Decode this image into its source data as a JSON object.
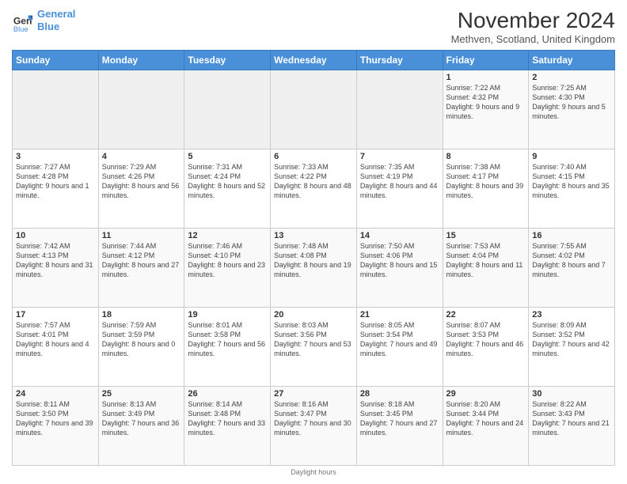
{
  "app": {
    "logo_line1": "General",
    "logo_line2": "Blue"
  },
  "title": "November 2024",
  "location": "Methven, Scotland, United Kingdom",
  "footer": "Daylight hours",
  "headers": [
    "Sunday",
    "Monday",
    "Tuesday",
    "Wednesday",
    "Thursday",
    "Friday",
    "Saturday"
  ],
  "weeks": [
    [
      {
        "day": "",
        "info": ""
      },
      {
        "day": "",
        "info": ""
      },
      {
        "day": "",
        "info": ""
      },
      {
        "day": "",
        "info": ""
      },
      {
        "day": "",
        "info": ""
      },
      {
        "day": "1",
        "info": "Sunrise: 7:22 AM\nSunset: 4:32 PM\nDaylight: 9 hours\nand 9 minutes."
      },
      {
        "day": "2",
        "info": "Sunrise: 7:25 AM\nSunset: 4:30 PM\nDaylight: 9 hours\nand 5 minutes."
      }
    ],
    [
      {
        "day": "3",
        "info": "Sunrise: 7:27 AM\nSunset: 4:28 PM\nDaylight: 9 hours\nand 1 minute."
      },
      {
        "day": "4",
        "info": "Sunrise: 7:29 AM\nSunset: 4:26 PM\nDaylight: 8 hours\nand 56 minutes."
      },
      {
        "day": "5",
        "info": "Sunrise: 7:31 AM\nSunset: 4:24 PM\nDaylight: 8 hours\nand 52 minutes."
      },
      {
        "day": "6",
        "info": "Sunrise: 7:33 AM\nSunset: 4:22 PM\nDaylight: 8 hours\nand 48 minutes."
      },
      {
        "day": "7",
        "info": "Sunrise: 7:35 AM\nSunset: 4:19 PM\nDaylight: 8 hours\nand 44 minutes."
      },
      {
        "day": "8",
        "info": "Sunrise: 7:38 AM\nSunset: 4:17 PM\nDaylight: 8 hours\nand 39 minutes."
      },
      {
        "day": "9",
        "info": "Sunrise: 7:40 AM\nSunset: 4:15 PM\nDaylight: 8 hours\nand 35 minutes."
      }
    ],
    [
      {
        "day": "10",
        "info": "Sunrise: 7:42 AM\nSunset: 4:13 PM\nDaylight: 8 hours\nand 31 minutes."
      },
      {
        "day": "11",
        "info": "Sunrise: 7:44 AM\nSunset: 4:12 PM\nDaylight: 8 hours\nand 27 minutes."
      },
      {
        "day": "12",
        "info": "Sunrise: 7:46 AM\nSunset: 4:10 PM\nDaylight: 8 hours\nand 23 minutes."
      },
      {
        "day": "13",
        "info": "Sunrise: 7:48 AM\nSunset: 4:08 PM\nDaylight: 8 hours\nand 19 minutes."
      },
      {
        "day": "14",
        "info": "Sunrise: 7:50 AM\nSunset: 4:06 PM\nDaylight: 8 hours\nand 15 minutes."
      },
      {
        "day": "15",
        "info": "Sunrise: 7:53 AM\nSunset: 4:04 PM\nDaylight: 8 hours\nand 11 minutes."
      },
      {
        "day": "16",
        "info": "Sunrise: 7:55 AM\nSunset: 4:02 PM\nDaylight: 8 hours\nand 7 minutes."
      }
    ],
    [
      {
        "day": "17",
        "info": "Sunrise: 7:57 AM\nSunset: 4:01 PM\nDaylight: 8 hours\nand 4 minutes."
      },
      {
        "day": "18",
        "info": "Sunrise: 7:59 AM\nSunset: 3:59 PM\nDaylight: 8 hours\nand 0 minutes."
      },
      {
        "day": "19",
        "info": "Sunrise: 8:01 AM\nSunset: 3:58 PM\nDaylight: 7 hours\nand 56 minutes."
      },
      {
        "day": "20",
        "info": "Sunrise: 8:03 AM\nSunset: 3:56 PM\nDaylight: 7 hours\nand 53 minutes."
      },
      {
        "day": "21",
        "info": "Sunrise: 8:05 AM\nSunset: 3:54 PM\nDaylight: 7 hours\nand 49 minutes."
      },
      {
        "day": "22",
        "info": "Sunrise: 8:07 AM\nSunset: 3:53 PM\nDaylight: 7 hours\nand 46 minutes."
      },
      {
        "day": "23",
        "info": "Sunrise: 8:09 AM\nSunset: 3:52 PM\nDaylight: 7 hours\nand 42 minutes."
      }
    ],
    [
      {
        "day": "24",
        "info": "Sunrise: 8:11 AM\nSunset: 3:50 PM\nDaylight: 7 hours\nand 39 minutes."
      },
      {
        "day": "25",
        "info": "Sunrise: 8:13 AM\nSunset: 3:49 PM\nDaylight: 7 hours\nand 36 minutes."
      },
      {
        "day": "26",
        "info": "Sunrise: 8:14 AM\nSunset: 3:48 PM\nDaylight: 7 hours\nand 33 minutes."
      },
      {
        "day": "27",
        "info": "Sunrise: 8:16 AM\nSunset: 3:47 PM\nDaylight: 7 hours\nand 30 minutes."
      },
      {
        "day": "28",
        "info": "Sunrise: 8:18 AM\nSunset: 3:45 PM\nDaylight: 7 hours\nand 27 minutes."
      },
      {
        "day": "29",
        "info": "Sunrise: 8:20 AM\nSunset: 3:44 PM\nDaylight: 7 hours\nand 24 minutes."
      },
      {
        "day": "30",
        "info": "Sunrise: 8:22 AM\nSunset: 3:43 PM\nDaylight: 7 hours\nand 21 minutes."
      }
    ]
  ]
}
